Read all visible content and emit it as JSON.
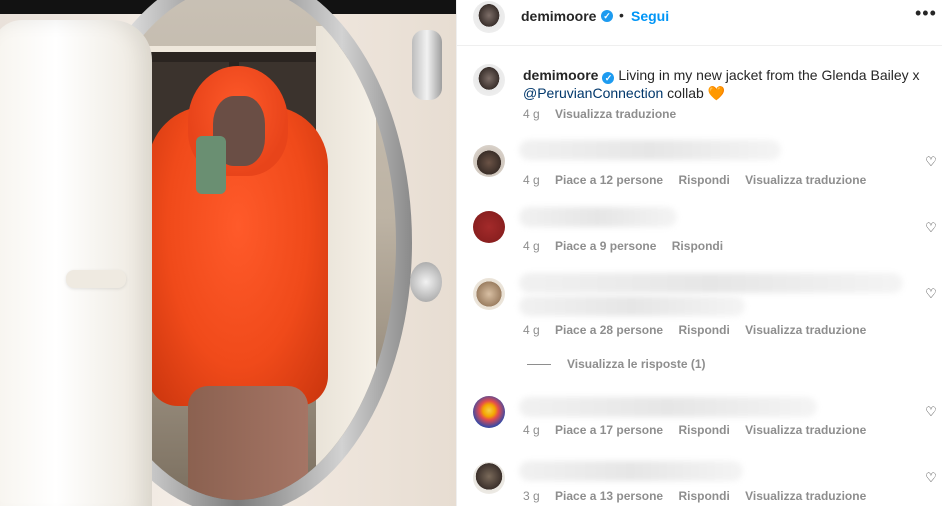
{
  "post": {
    "image_alt_subject": "",
    "colors": {
      "accent": "#0095f6",
      "verified": "#1d9bf0",
      "jacket": "#f04a1a"
    }
  },
  "header": {
    "username": "demimoore",
    "separator": "•",
    "follow_label": "Segui",
    "more_icon": "more-horizontal-icon"
  },
  "caption": {
    "username": "demimoore",
    "text_before": " Living in my new jacket from the Glenda Bailey x ",
    "mention": "@PeruvianConnection",
    "text_after": " collab ",
    "emoji": "🧡",
    "time": "4 g",
    "translate_label": "Visualizza traduzione"
  },
  "comments": [
    {
      "time": "4 g",
      "likes": "Piace a 12 persone",
      "reply": "Rispondi",
      "translate": "Visualizza traduzione"
    },
    {
      "time": "4 g",
      "likes": "Piace a 9 persone",
      "reply": "Rispondi",
      "translate": ""
    },
    {
      "time": "4 g",
      "likes": "Piace a 28 persone",
      "reply": "Rispondi",
      "translate": "Visualizza traduzione"
    },
    {
      "time": "4 g",
      "likes": "Piace a 17 persone",
      "reply": "Rispondi",
      "translate": "Visualizza traduzione"
    },
    {
      "time": "3 g",
      "likes": "Piace a 13 persone",
      "reply": "Rispondi",
      "translate": "Visualizza traduzione"
    }
  ],
  "replies_toggle": "Visualizza le risposte (1)",
  "icons": {
    "like": "heart-outline-icon",
    "verified": "verified-badge-icon"
  }
}
